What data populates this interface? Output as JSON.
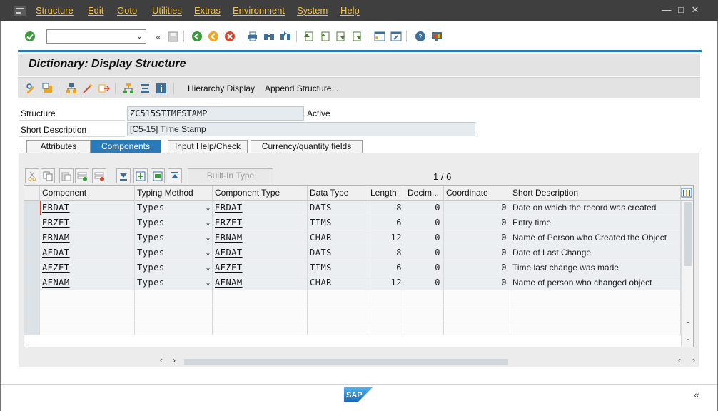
{
  "menu": {
    "items": [
      "Structure",
      "Edit",
      "Goto",
      "Utilities",
      "Extras",
      "Environment",
      "System",
      "Help"
    ]
  },
  "title": "Dictionary: Display Structure",
  "app_toolbar": {
    "hierarchy_display": "Hierarchy Display",
    "append_structure": "Append Structure..."
  },
  "header": {
    "structure_label": "Structure",
    "structure_value": "ZC515STIMESTAMP",
    "status": "Active",
    "short_desc_label": "Short Description",
    "short_desc_value": "[C5-15] Time Stamp"
  },
  "tabs": [
    {
      "label": "Attributes",
      "active": false
    },
    {
      "label": "Components",
      "active": true
    },
    {
      "label": "Input Help/Check",
      "active": false
    },
    {
      "label": "Currency/quantity fields",
      "active": false
    }
  ],
  "table": {
    "builtin_type_button": "Built-In Type",
    "pager": "1 / 6",
    "columns": [
      "Component",
      "Typing Method",
      "Component Type",
      "Data Type",
      "Length",
      "Decim...",
      "Coordinate",
      "Short Description"
    ],
    "rows": [
      {
        "component": "ERDAT",
        "typing": "Types",
        "ctype": "ERDAT",
        "dtype": "DATS",
        "length": "8",
        "decimals": "0",
        "coord": "0",
        "desc": "Date on which the record was created"
      },
      {
        "component": "ERZET",
        "typing": "Types",
        "ctype": "ERZET",
        "dtype": "TIMS",
        "length": "6",
        "decimals": "0",
        "coord": "0",
        "desc": "Entry time"
      },
      {
        "component": "ERNAM",
        "typing": "Types",
        "ctype": "ERNAM",
        "dtype": "CHAR",
        "length": "12",
        "decimals": "0",
        "coord": "0",
        "desc": "Name of Person who Created the Object"
      },
      {
        "component": "AEDAT",
        "typing": "Types",
        "ctype": "AEDAT",
        "dtype": "DATS",
        "length": "8",
        "decimals": "0",
        "coord": "0",
        "desc": "Date of Last Change"
      },
      {
        "component": "AEZET",
        "typing": "Types",
        "ctype": "AEZET",
        "dtype": "TIMS",
        "length": "6",
        "decimals": "0",
        "coord": "0",
        "desc": "Time last change was made"
      },
      {
        "component": "AENAM",
        "typing": "Types",
        "ctype": "AENAM",
        "dtype": "CHAR",
        "length": "12",
        "decimals": "0",
        "coord": "0",
        "desc": "Name of person who changed object"
      }
    ]
  },
  "colors": {
    "accent": "#2a79b8",
    "menu_text": "#f0c24b",
    "menu_bg": "#3f3f3f",
    "cell_bg": "#ebeff2"
  }
}
